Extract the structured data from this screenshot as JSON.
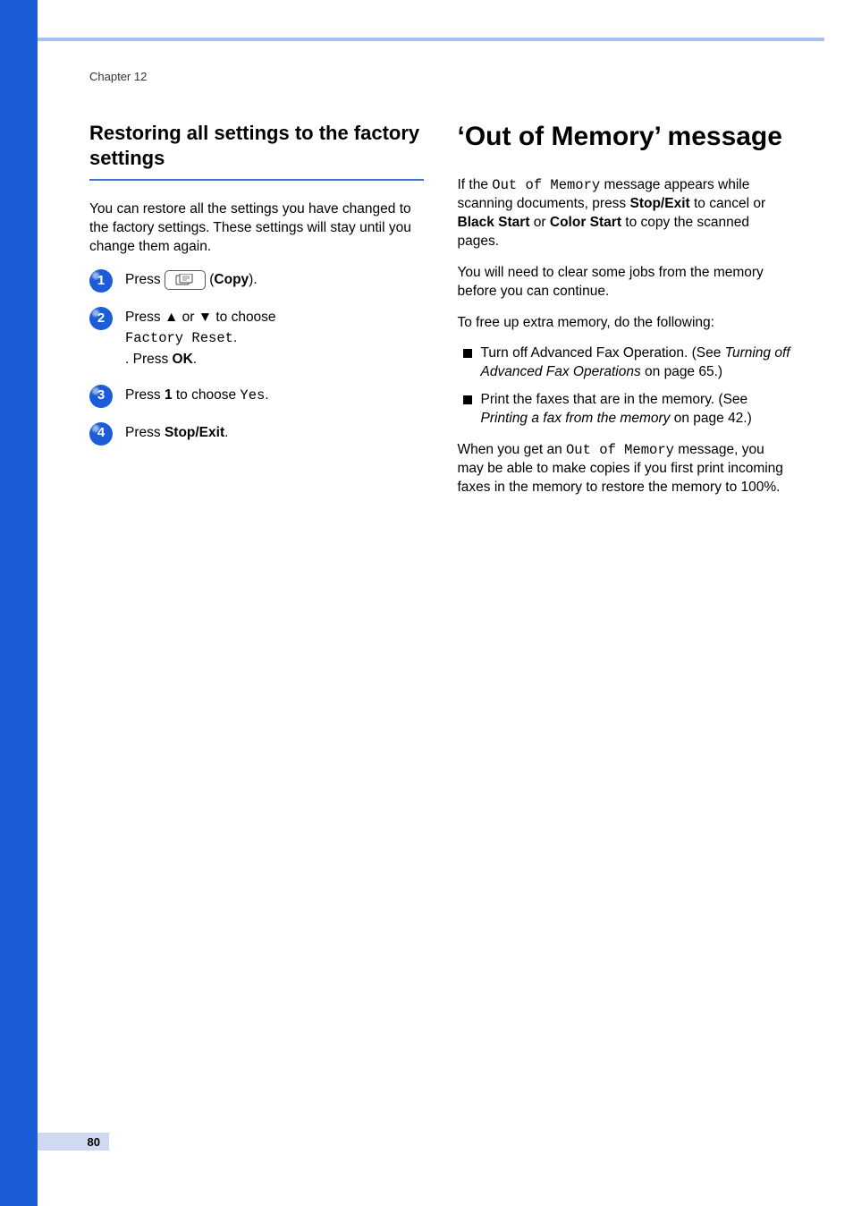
{
  "chapter": "Chapter 12",
  "page_number": "80",
  "left": {
    "heading": "Restoring all settings to the factory settings",
    "intro": "You can restore all the settings you have changed to the factory settings. These settings will stay until you change them again.",
    "steps": {
      "s1": {
        "press": "Press ",
        "copy_label": "Copy",
        "after": ")."
      },
      "s2": {
        "a": "Press ",
        "or": " or ",
        "b": " to choose ",
        "opt": "Factory Reset",
        "c": ". Press ",
        "ok": "OK",
        "d": "."
      },
      "s3": {
        "a": "Press ",
        "one": "1",
        "b": " to choose ",
        "yes": "Yes",
        "c": "."
      },
      "s4": {
        "a": "Press ",
        "stop": "Stop/Exit",
        "b": "."
      }
    }
  },
  "right": {
    "heading": "‘Out of Memory’ message",
    "p1": {
      "a": "If the ",
      "msg": "Out of Memory",
      "b": " message appears while scanning documents, press ",
      "stop": "Stop/Exit",
      "c": " to cancel or ",
      "black": "Black Start",
      "d": " or ",
      "color": "Color Start",
      "e": " to copy the scanned pages."
    },
    "p2": "You will need to clear some jobs from the memory before you can continue.",
    "p3": "To free up extra memory, do the following:",
    "bullets": {
      "b1": {
        "a": "Turn off Advanced Fax Operation. (See ",
        "link": "Turning off Advanced Fax Operations",
        "b": " on page 65.)"
      },
      "b2": {
        "a": "Print the faxes that are in the memory. (See ",
        "link": "Printing a fax from the memory",
        "b": " on page 42.)"
      }
    },
    "p4": {
      "a": "When you get an ",
      "msg": "Out of Memory",
      "b": " message, you may be able to make copies if you first print incoming faxes in the memory to restore the memory to 100%."
    }
  }
}
